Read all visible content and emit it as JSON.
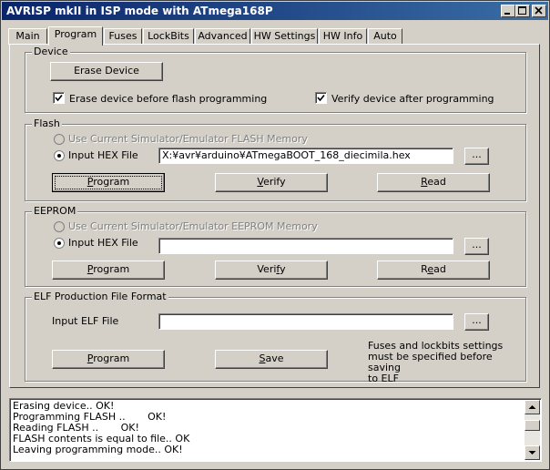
{
  "window": {
    "title": "AVRISP mkII in ISP mode with ATmega168P",
    "controls": [
      "minimize-icon",
      "maximize-icon",
      "close-icon"
    ]
  },
  "tabs": [
    {
      "label": "Main"
    },
    {
      "label": "Program",
      "active": true
    },
    {
      "label": "Fuses"
    },
    {
      "label": "LockBits"
    },
    {
      "label": "Advanced"
    },
    {
      "label": "HW Settings"
    },
    {
      "label": "HW Info"
    },
    {
      "label": "Auto"
    }
  ],
  "device": {
    "legend": "Device",
    "erase_button": "Erase Device",
    "erase_before_label": "Erase device before flash programming",
    "erase_before_checked": true,
    "verify_after_label": "Verify device after programming",
    "verify_after_checked": true
  },
  "flash": {
    "legend": "Flash",
    "use_current_label": "Use Current Simulator/Emulator FLASH Memory",
    "input_hex_label": "Input HEX File",
    "input_hex_selected": true,
    "hex_path": "X:¥avr¥arduino¥ATmegaBOOT_168_diecimila.hex",
    "browse_label": "...",
    "program_button": {
      "pre": "",
      "ul": "P",
      "post": "rogram"
    },
    "verify_button": {
      "pre": "",
      "ul": "V",
      "post": "erify"
    },
    "read_button": {
      "pre": "",
      "ul": "R",
      "post": "ead"
    }
  },
  "eeprom": {
    "legend": "EEPROM",
    "use_current_label": "Use Current Simulator/Emulator EEPROM Memory",
    "input_hex_label": "Input HEX File",
    "input_hex_selected": true,
    "hex_path": "",
    "browse_label": "...",
    "program_button": {
      "pre": "",
      "ul": "P",
      "post": "rogram"
    },
    "verify_button": {
      "pre": "Veri",
      "ul": "f",
      "post": "y"
    },
    "read_button": {
      "pre": "R",
      "ul": "e",
      "post": "ad"
    }
  },
  "elf": {
    "legend": "ELF Production File Format",
    "input_label": "Input ELF File",
    "elf_path": "",
    "browse_label": "...",
    "program_button": {
      "pre": "",
      "ul": "P",
      "post": "rogram"
    },
    "save_button": {
      "pre": "",
      "ul": "S",
      "post": "ave"
    },
    "note": "Fuses and lockbits settings\nmust be specified before saving\nto ELF"
  },
  "log": {
    "lines": [
      "Erasing device.. OK!",
      "Programming FLASH ..       OK!",
      "Reading FLASH ..       OK!",
      "FLASH contents is equal to file.. OK",
      "Leaving programming mode.. OK!"
    ],
    "scroll_icons": [
      "scroll-up-icon",
      "scroll-down-icon"
    ]
  }
}
